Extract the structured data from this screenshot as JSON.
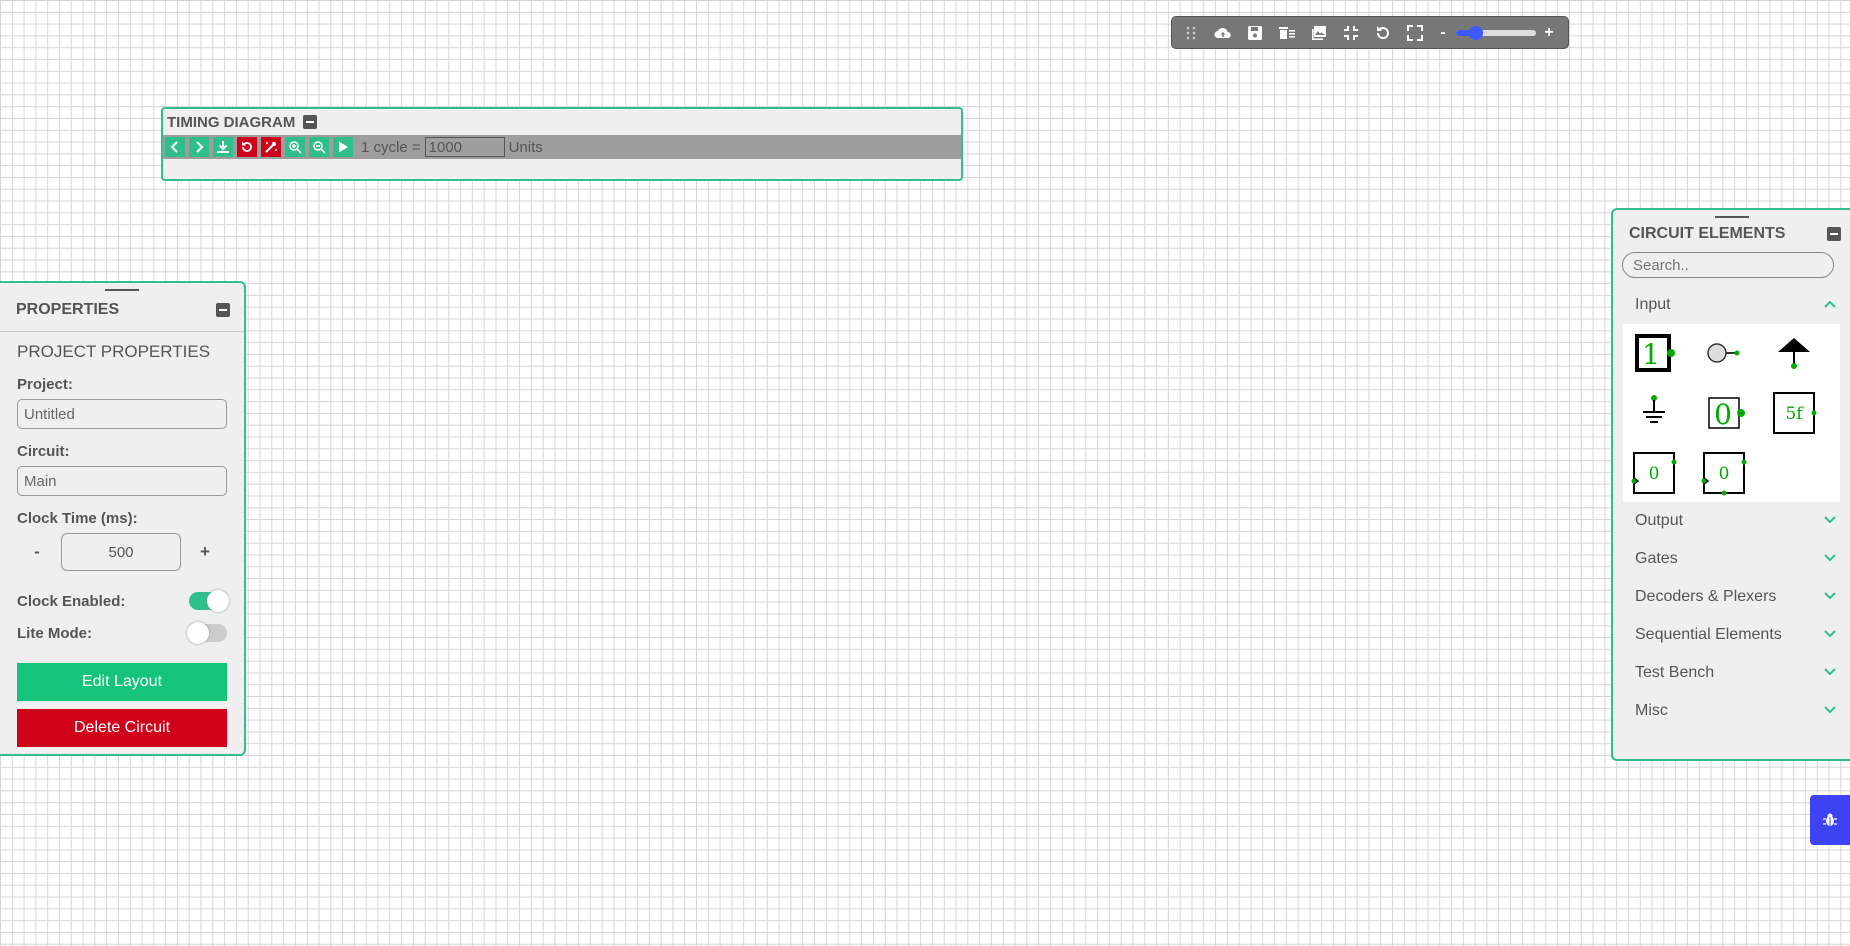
{
  "toolbar": {
    "icons": [
      "drag-handle-icon",
      "cloud-upload-icon",
      "save-icon",
      "delete-icon",
      "image-icon",
      "fit-screen-icon",
      "undo-icon",
      "fullscreen-icon"
    ],
    "zoom_minus": "-",
    "zoom_plus": "+",
    "zoom_level": 0.25
  },
  "timing": {
    "title": "TIMING DIAGRAM",
    "cycle_label": "1 cycle =",
    "cycle_value": "1000",
    "units_label": "Units"
  },
  "properties": {
    "title": "PROPERTIES",
    "section_title": "PROJECT PROPERTIES",
    "project_label": "Project:",
    "project_value": "Untitled",
    "circuit_label": "Circuit:",
    "circuit_value": "Main",
    "clock_time_label": "Clock Time (ms):",
    "clock_minus": "-",
    "clock_value": "500",
    "clock_plus": "+",
    "clock_enabled_label": "Clock Enabled:",
    "clock_enabled": true,
    "lite_mode_label": "Lite Mode:",
    "lite_mode": false,
    "edit_layout": "Edit Layout",
    "delete_circuit": "Delete Circuit"
  },
  "elements": {
    "title": "CIRCUIT ELEMENTS",
    "search_placeholder": "Search..",
    "categories": [
      {
        "label": "Input",
        "expanded": true
      },
      {
        "label": "Output",
        "expanded": false
      },
      {
        "label": "Gates",
        "expanded": false
      },
      {
        "label": "Decoders & Plexers",
        "expanded": false
      },
      {
        "label": "Sequential Elements",
        "expanded": false
      },
      {
        "label": "Test Bench",
        "expanded": false
      },
      {
        "label": "Misc",
        "expanded": false
      }
    ],
    "input_items": {
      "input_value": "1",
      "constant_value": "0",
      "random_value": "5f",
      "counter_a_value": "0",
      "counter_b_value": "0"
    }
  },
  "colors": {
    "accent": "#2fbf8a",
    "danger": "#d0021b",
    "primary": "#16c37a",
    "bug": "#3d42f5"
  }
}
